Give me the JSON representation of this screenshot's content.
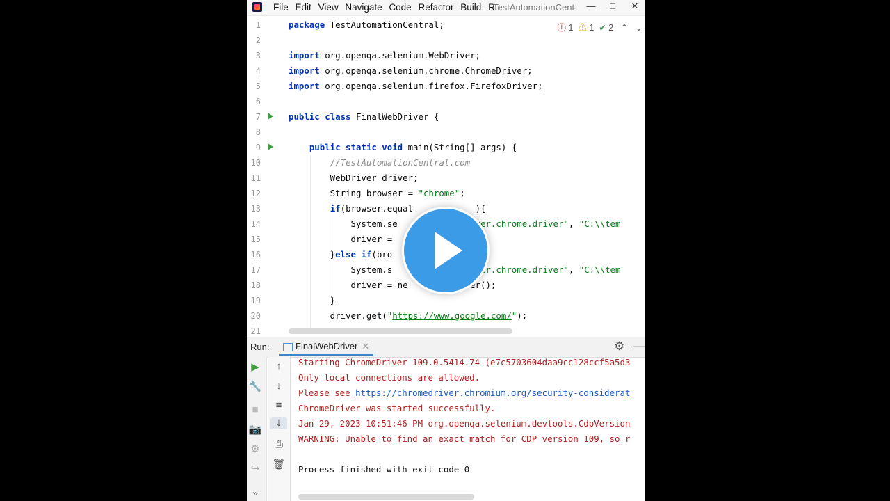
{
  "menu": [
    "File",
    "Edit",
    "View",
    "Navigate",
    "Code",
    "Refactor",
    "Build",
    "Ru"
  ],
  "project_title": "TestAutomationCentr",
  "window_controls": {
    "minimize": "—",
    "maximize": "□",
    "close": "✕"
  },
  "inspections": {
    "errors": "1",
    "warnings": "1",
    "typos": "2"
  },
  "editor_lines": [
    {
      "n": "1",
      "html": "<span class='kw'>package</span> TestAutomationCentral;"
    },
    {
      "n": "2",
      "html": ""
    },
    {
      "n": "3",
      "html": "<span class='kw'>import</span> org.openqa.selenium.WebDriver;"
    },
    {
      "n": "4",
      "html": "<span class='kw'>import</span> org.openqa.selenium.chrome.ChromeDriver;"
    },
    {
      "n": "5",
      "html": "<span class='kw'>import</span> org.openqa.selenium.firefox.FirefoxDriver;"
    },
    {
      "n": "6",
      "html": ""
    },
    {
      "n": "7",
      "html": "<span class='kw'>public class</span> FinalWebDriver {"
    },
    {
      "n": "8",
      "html": ""
    },
    {
      "n": "9",
      "html": "    <span class='kw'>public static void</span> main(String[] args) {"
    },
    {
      "n": "10",
      "html": "        <span class='cm'>//TestAutomationCentral.com</span>"
    },
    {
      "n": "11",
      "html": "        WebDriver driver;"
    },
    {
      "n": "12",
      "html": "        String browser = <span class='str'>\"chrome\"</span>;"
    },
    {
      "n": "13",
      "html": "        <span class='kw'>if</span>(browser.equal            ){"
    },
    {
      "n": "14",
      "html": "            System.se              <span class='str'>iver.chrome.driver\"</span>, <span class='str'>\"C:\\\\tem</span>"
    },
    {
      "n": "15",
      "html": "            driver =               );"
    },
    {
      "n": "16",
      "html": "        }<span class='kw'>else if</span>(bro          <span class='str'>ox\"</span>)){"
    },
    {
      "n": "17",
      "html": "            System.s               <span class='str'>iver.chrome.driver\"</span>, <span class='str'>\"C:\\\\tem</span>"
    },
    {
      "n": "18",
      "html": "            driver = ne           ver();"
    },
    {
      "n": "19",
      "html": "        }"
    },
    {
      "n": "20",
      "html": "        driver.get(<span class='str'>\"<u>https://www.google.com/</u>\"</span>);"
    },
    {
      "n": "21",
      "html": ""
    }
  ],
  "run_label": "Run:",
  "run_tab": "FinalWebDriver",
  "console_lines": [
    {
      "type": "err",
      "text": "Starting ChromeDriver 109.0.5414.74 (e7c5703604daa9cc128ccf5a5d3"
    },
    {
      "type": "err",
      "text": "Only local connections are allowed."
    },
    {
      "type": "err",
      "prefix": "Please see ",
      "link": "https://chromedriver.chromium.org/security-considerat"
    },
    {
      "type": "err",
      "text": "ChromeDriver was started successfully."
    },
    {
      "type": "err",
      "text": "Jan 29, 2023 10:51:46 PM org.openqa.selenium.devtools.CdpVersion"
    },
    {
      "type": "err",
      "text": "WARNING: Unable to find an exact match for CDP version 109, so r"
    },
    {
      "type": "err",
      "text": ""
    },
    {
      "type": "normal",
      "text": "Process finished with exit code 0"
    }
  ]
}
